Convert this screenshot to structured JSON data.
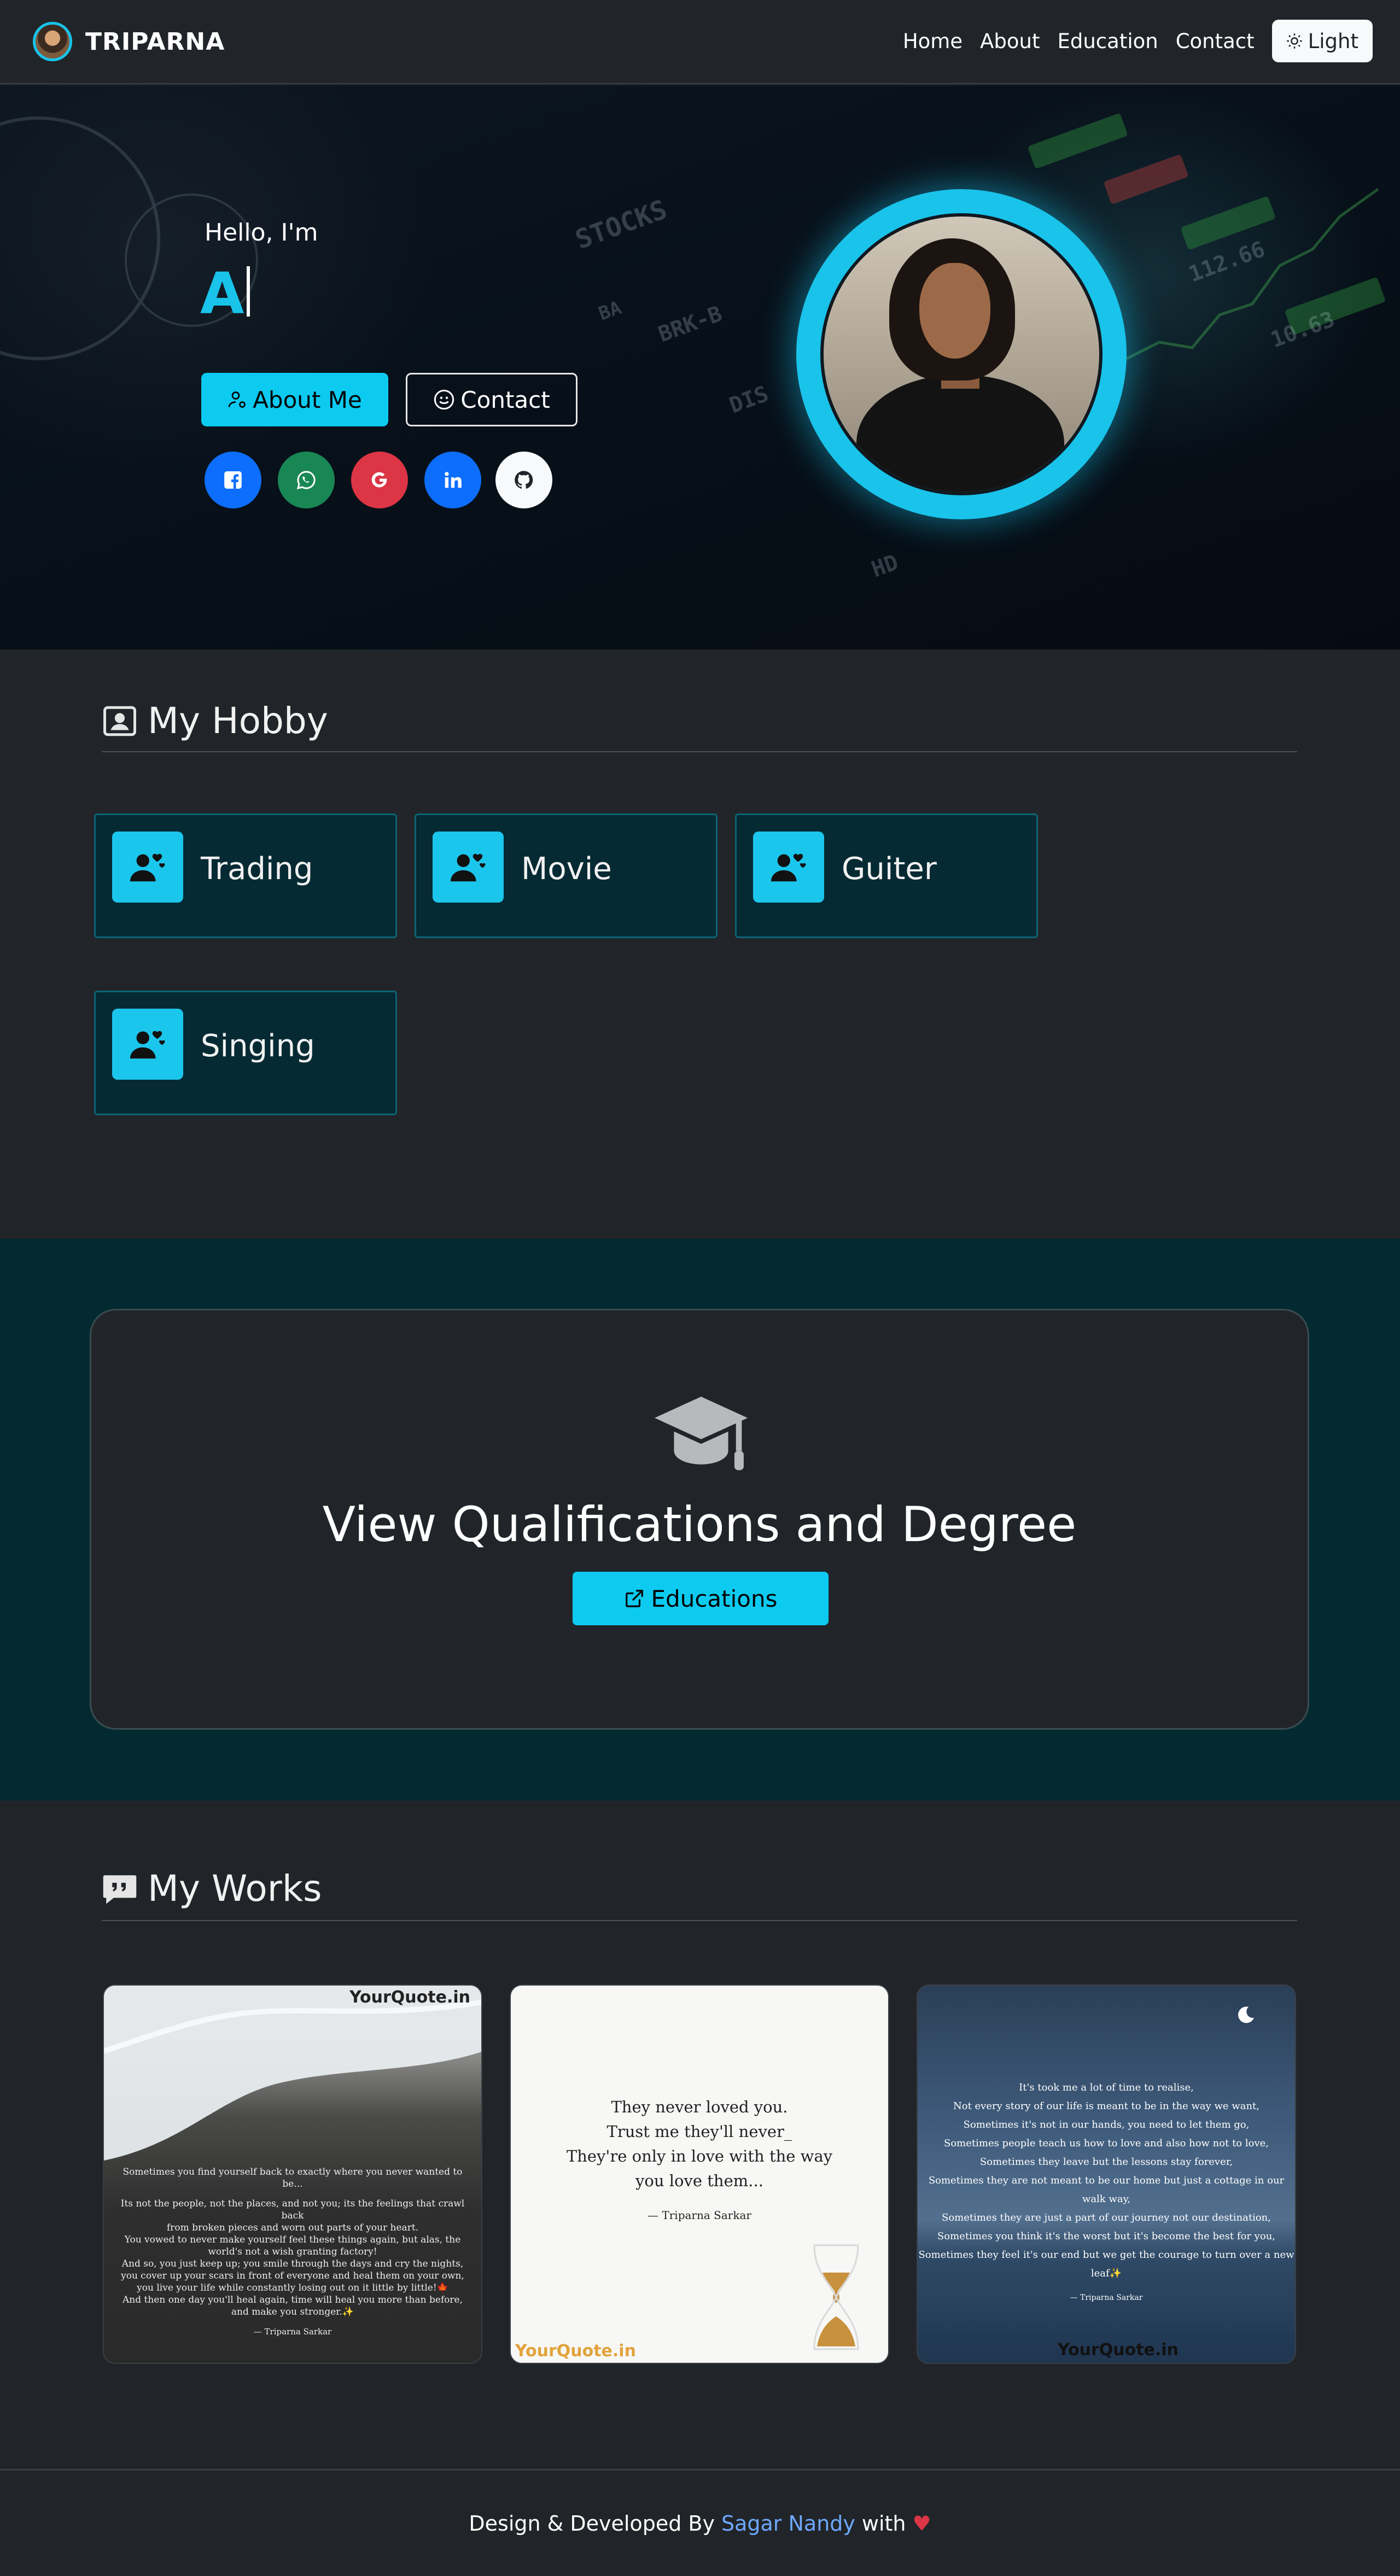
{
  "nav": {
    "brand": "TRIPARNA",
    "links": [
      "Home",
      "About",
      "Education",
      "Contact"
    ],
    "theme_toggle": "Light"
  },
  "hero": {
    "greeting": "Hello, I'm",
    "typed_text": "A",
    "about_button": "About Me",
    "contact_button": "Contact",
    "socials": [
      {
        "name": "facebook-icon",
        "color": "#0d6efd"
      },
      {
        "name": "whatsapp-icon",
        "color": "#198754"
      },
      {
        "name": "google-icon",
        "color": "#dc3545"
      },
      {
        "name": "linkedin-icon",
        "color": "#0d6efd"
      },
      {
        "name": "github-icon",
        "color": "#f8f9fa"
      }
    ],
    "accent": "#0dcaf0"
  },
  "hobby": {
    "title": "My Hobby",
    "items": [
      "Trading",
      "Movie",
      "Guiter",
      "Singing"
    ]
  },
  "education": {
    "title": "View Qualifications and Degree",
    "button": "Educations"
  },
  "works": {
    "title": "My Works",
    "cards": [
      {
        "watermark": "YourQuote.in",
        "lines": [
          "Sometimes you find yourself back to exactly where you never wanted to be...",
          "",
          "Its not the people, not the places, and not you; its the feelings that crawl back",
          "from broken pieces and worn out parts of your heart.",
          "You vowed to never make yourself feel these things again, but alas, the",
          "world's not a wish granting factory!",
          "And so, you just keep up; you smile through the days and cry the nights,",
          "you cover up your scars in front of everyone and heal them on your own,",
          "you live your life while constantly losing out on it little by little!🍁",
          "And then one day you'll heal again, time will heal you more than before,",
          "and make you stronger.✨"
        ],
        "author": "— Triparna Sarkar"
      },
      {
        "watermark": "YourQuote.in",
        "lines": [
          "They never loved you.",
          "Trust me they'll never_",
          "They're only in love with the way",
          "you love them..."
        ],
        "author": "— Triparna Sarkar"
      },
      {
        "watermark": "YourQuote.in",
        "lines": [
          "It's took me a lot of time to realise,",
          "Not every story of our life is meant to be in the way we want,",
          "Sometimes it's not in our hands, you need to let them go,",
          "Sometimes  people teach us how to love and also how not to love,",
          "Sometimes they leave but the lessons stay forever,",
          "Sometimes they are not meant to be our home but just a cottage in our walk way,",
          "Sometimes they are just a part of our journey not our destination,",
          "Sometimes you think it's the worst but it's become the best for you,",
          "Sometimes they feel it's our end but we get the courage to turn over a new leaf✨"
        ],
        "author": "— Triparna Sarkar"
      }
    ]
  },
  "footer": {
    "prefix": "Design & Developed By",
    "author": "Sagar Nandy",
    "suffix": "with",
    "heart": "♥"
  }
}
